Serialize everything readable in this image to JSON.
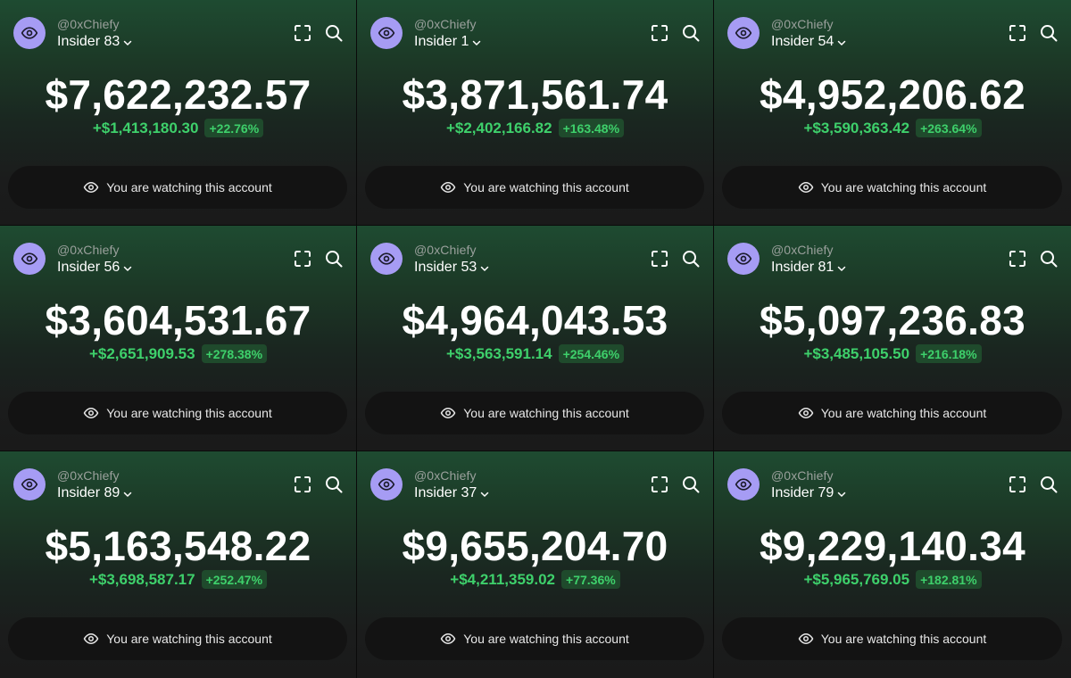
{
  "panels": [
    {
      "handle": "@0xChiefy",
      "account": "Insider 83",
      "balance": "$7,622,232.57",
      "change": "+$1,413,180.30",
      "percent": "+22.76%",
      "watch_label": "You are watching this account"
    },
    {
      "handle": "@0xChiefy",
      "account": "Insider 1",
      "balance": "$3,871,561.74",
      "change": "+$2,402,166.82",
      "percent": "+163.48%",
      "watch_label": "You are watching this account"
    },
    {
      "handle": "@0xChiefy",
      "account": "Insider 54",
      "balance": "$4,952,206.62",
      "change": "+$3,590,363.42",
      "percent": "+263.64%",
      "watch_label": "You are watching this account"
    },
    {
      "handle": "@0xChiefy",
      "account": "Insider 56",
      "balance": "$3,604,531.67",
      "change": "+$2,651,909.53",
      "percent": "+278.38%",
      "watch_label": "You are watching this account"
    },
    {
      "handle": "@0xChiefy",
      "account": "Insider 53",
      "balance": "$4,964,043.53",
      "change": "+$3,563,591.14",
      "percent": "+254.46%",
      "watch_label": "You are watching this account"
    },
    {
      "handle": "@0xChiefy",
      "account": "Insider 81",
      "balance": "$5,097,236.83",
      "change": "+$3,485,105.50",
      "percent": "+216.18%",
      "watch_label": "You are watching this account"
    },
    {
      "handle": "@0xChiefy",
      "account": "Insider 89",
      "balance": "$5,163,548.22",
      "change": "+$3,698,587.17",
      "percent": "+252.47%",
      "watch_label": "You are watching this account"
    },
    {
      "handle": "@0xChiefy",
      "account": "Insider 37",
      "balance": "$9,655,204.70",
      "change": "+$4,211,359.02",
      "percent": "+77.36%",
      "watch_label": "You are watching this account"
    },
    {
      "handle": "@0xChiefy",
      "account": "Insider 79",
      "balance": "$9,229,140.34",
      "change": "+$5,965,769.05",
      "percent": "+182.81%",
      "watch_label": "You are watching this account"
    }
  ],
  "icons": {
    "avatar": "eye-icon",
    "account_dropdown": "chevron-down-icon",
    "expand": "expand-icon",
    "search": "search-icon",
    "watch": "eye-icon"
  },
  "colors": {
    "avatar_bg": "#a69cf4",
    "positive": "#3ed06b",
    "percent_badge_bg": "#1f4a2c",
    "watch_button_bg": "#131313",
    "gradient_top": "#1e4b31",
    "gradient_bottom": "#1a1a1a"
  }
}
